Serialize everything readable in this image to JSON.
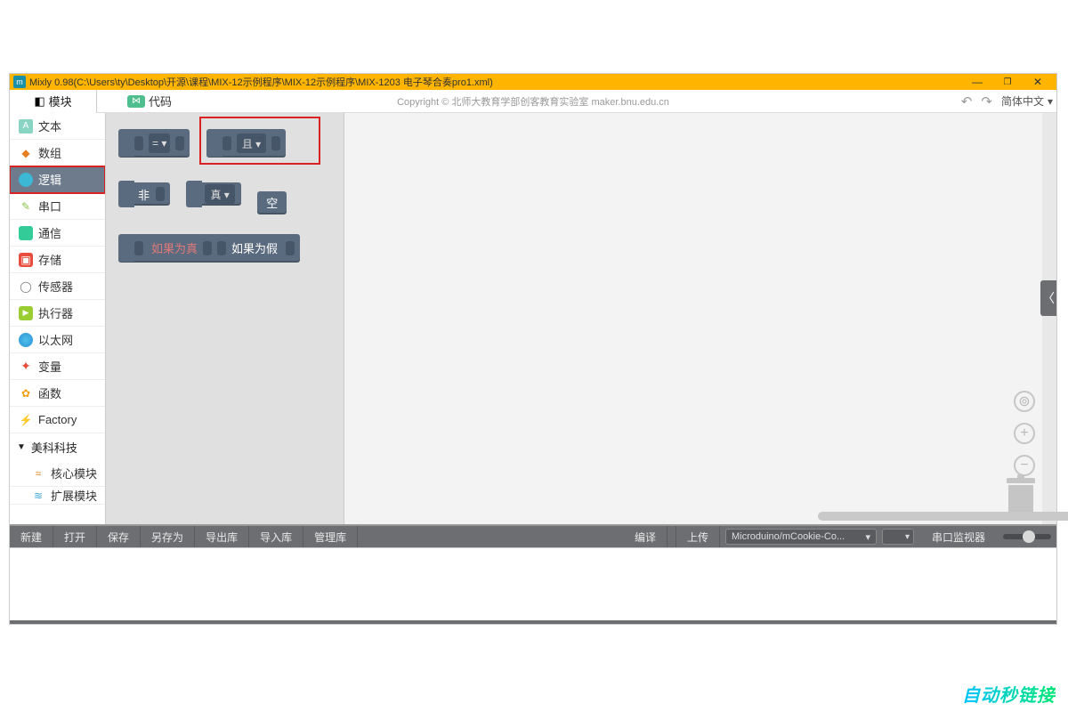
{
  "window": {
    "title": "Mixly 0.98(C:\\Users\\ty\\Desktop\\开源\\课程\\MIX-12示例程序\\MIX-12示例程序\\MIX-1203 电子琴合奏pro1.xml)",
    "minimize_tip": "—",
    "maximize_tip": "❐",
    "close_tip": "✕"
  },
  "header": {
    "tab_module": "模块",
    "tab_code": "代码",
    "copyright": "Copyright © 北师大教育学部创客教育实验室  maker.bnu.edu.cn",
    "undo": "↶",
    "redo": "↷",
    "lang_selected": "简体中文",
    "lang_arrow": "▾"
  },
  "sidebar": {
    "items": [
      {
        "label": "文本"
      },
      {
        "label": "数组"
      },
      {
        "label": "逻辑"
      },
      {
        "label": "串口"
      },
      {
        "label": "通信"
      },
      {
        "label": "存储"
      },
      {
        "label": "传感器"
      },
      {
        "label": "执行器"
      },
      {
        "label": "以太网"
      },
      {
        "label": "变量"
      },
      {
        "label": "函数"
      },
      {
        "label": "Factory"
      }
    ],
    "group": {
      "tri": "▼",
      "label": "美科科技"
    },
    "subitems": [
      {
        "label": "核心模块"
      },
      {
        "label": "扩展模块"
      }
    ]
  },
  "flyout": {
    "block_eq_op": "= ▾",
    "block_and_op": "且 ▾",
    "block_not": "非",
    "block_true": "真 ▾",
    "block_null": "空",
    "block_iftrue": "如果为真",
    "block_iffalse": "如果为假"
  },
  "workspace": {
    "expand_arrow": "〈",
    "target_icon": "⊚",
    "zoom_in": "+",
    "zoom_out": "−"
  },
  "toolbar": {
    "buttons": [
      "新建",
      "打开",
      "保存",
      "另存为",
      "导出库",
      "导入库",
      "管理库"
    ],
    "compile": "编译",
    "upload": "上传",
    "board_selected": "Microduino/mCookie-Co...",
    "board_arrow": "▾",
    "port_arrow": "▾",
    "serial_monitor": "串口监视器"
  },
  "watermark": "自动秒链接"
}
